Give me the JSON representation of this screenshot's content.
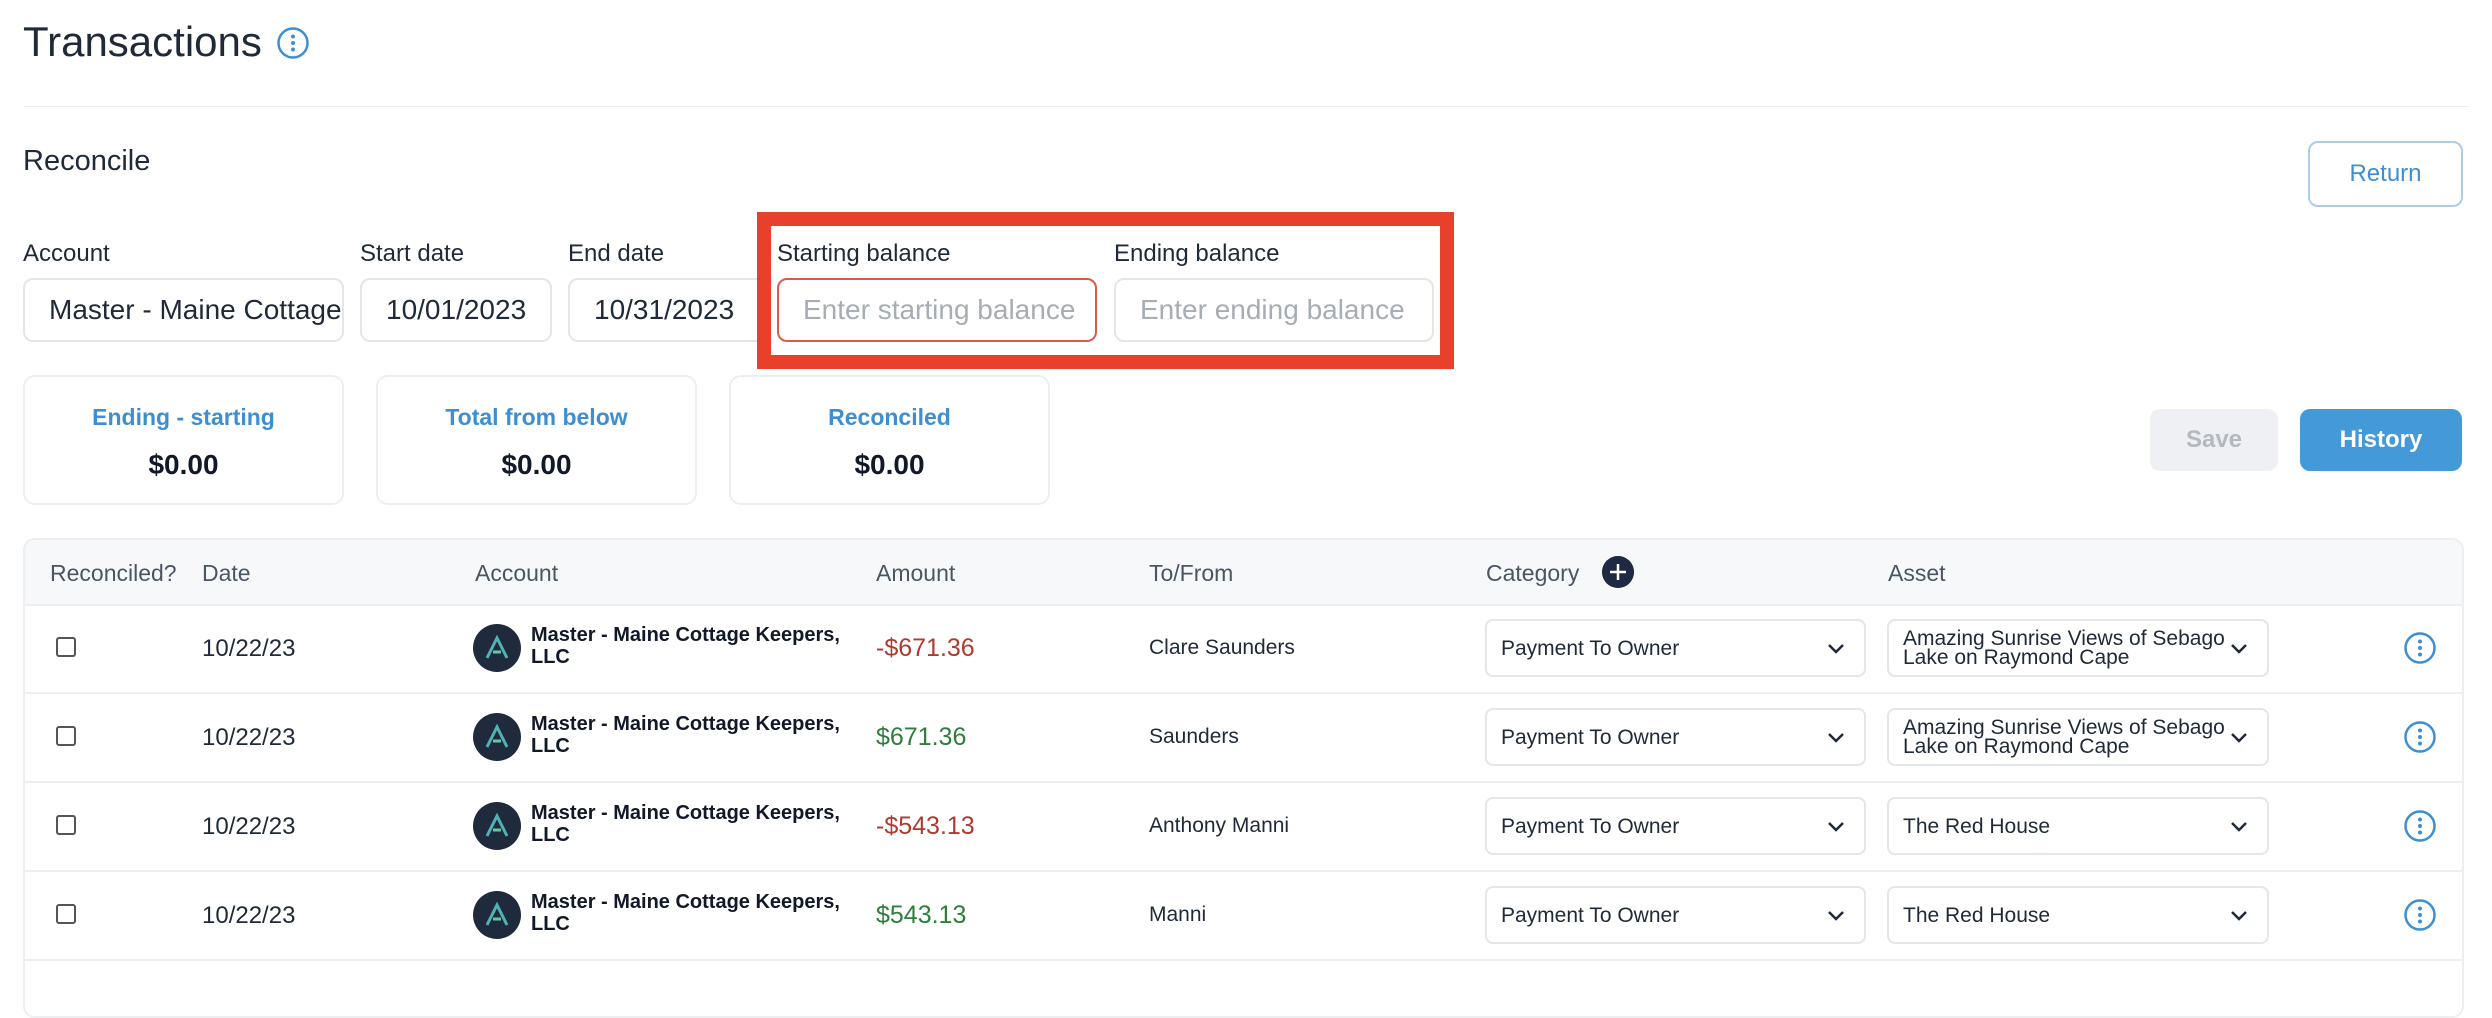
{
  "page": {
    "title": "Transactions",
    "info_icon": "info-circle-icon"
  },
  "reconcile": {
    "title": "Reconcile",
    "return_label": "Return",
    "fields": {
      "account": {
        "label": "Account",
        "value": "Master - Maine Cottage Keepers, LLC"
      },
      "start_date": {
        "label": "Start date",
        "value": "10/01/2023"
      },
      "end_date": {
        "label": "End date",
        "value": "10/31/2023"
      },
      "starting_balance": {
        "label": "Starting balance",
        "placeholder": "Enter starting balance"
      },
      "ending_balance": {
        "label": "Ending balance",
        "placeholder": "Enter ending balance"
      }
    },
    "stats": [
      {
        "label": "Ending - starting",
        "value": "$0.00"
      },
      {
        "label": "Total from below",
        "value": "$0.00"
      },
      {
        "label": "Reconciled",
        "value": "$0.00"
      }
    ],
    "save_label": "Save",
    "history_label": "History"
  },
  "table": {
    "headers": {
      "reconciled": "Reconciled?",
      "date": "Date",
      "account": "Account",
      "amount": "Amount",
      "to_from": "To/From",
      "category": "Category",
      "asset": "Asset"
    },
    "rows": [
      {
        "date": "10/22/23",
        "account": "Master - Maine Cottage Keepers, LLC",
        "amount": "-$671.36",
        "to_from": "Clare Saunders",
        "category": "Payment To Owner",
        "asset": "Amazing Sunrise Views of Sebago Lake on Raymond Cape"
      },
      {
        "date": "10/22/23",
        "account": "Master - Maine Cottage Keepers, LLC",
        "amount": "$671.36",
        "to_from": "Saunders",
        "category": "Payment To Owner",
        "asset": "Amazing Sunrise Views of Sebago Lake on Raymond Cape"
      },
      {
        "date": "10/22/23",
        "account": "Master - Maine Cottage Keepers, LLC",
        "amount": "-$543.13",
        "to_from": "Anthony Manni",
        "category": "Payment To Owner",
        "asset": "The Red House"
      },
      {
        "date": "10/22/23",
        "account": "Master - Maine Cottage Keepers, LLC",
        "amount": "$543.13",
        "to_from": "Manni",
        "category": "Payment To Owner",
        "asset": "The Red House"
      }
    ]
  },
  "colors": {
    "accent": "#4499d8",
    "negative": "#b03a2e",
    "positive": "#2f7d3b",
    "highlight": "#e8402a"
  }
}
